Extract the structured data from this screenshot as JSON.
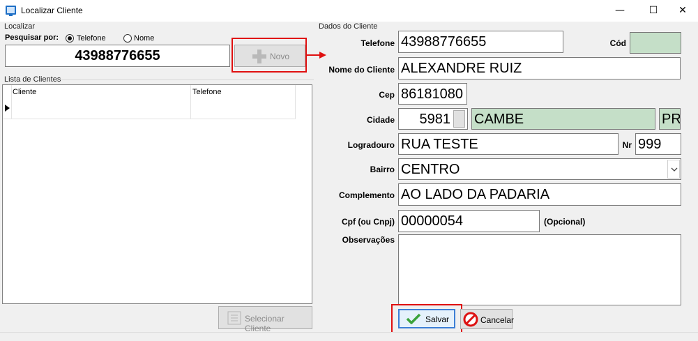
{
  "window": {
    "title": "Localizar Cliente",
    "minimize": "—",
    "maximize": "☐",
    "close": "✕"
  },
  "search": {
    "group_label": "Localizar",
    "search_by_label": "Pesquisar por:",
    "option_phone": "Telefone",
    "option_name": "Nome",
    "selected": "Telefone",
    "value": "43988776655",
    "new_button": "Novo"
  },
  "client_list": {
    "group_label": "Lista de Clientes",
    "columns": [
      "Cliente",
      "Telefone"
    ],
    "rows": [],
    "select_button": "Selecionar Cliente"
  },
  "client_data": {
    "group_label": "Dados do Cliente",
    "phone_label": "Telefone",
    "phone": "43988776655",
    "code_label": "Cód",
    "code": "",
    "name_label": "Nome do Cliente",
    "name": "ALEXANDRE RUIZ",
    "cep_label": "Cep",
    "cep": "86181080",
    "city_label": "Cidade",
    "city_code": "5981",
    "city_name": "CAMBE",
    "state": "PR",
    "street_label": "Logradouro",
    "street": "RUA TESTE",
    "number_label": "Nr",
    "number": "999",
    "district_label": "Bairro",
    "district": "CENTRO",
    "complement_label": "Complemento",
    "complement": "AO LADO DA PADARIA",
    "cpf_label": "Cpf (ou Cnpj)",
    "cpf": "00000054",
    "optional_note": "(Opcional)",
    "notes_label": "Observações",
    "notes": "",
    "save_button": "Salvar",
    "cancel_button": "Cancelar"
  },
  "colors": {
    "highlight_box": "#e01010",
    "readonly_field": "#c5dfc8",
    "save_focus": "#3c7fd6"
  }
}
